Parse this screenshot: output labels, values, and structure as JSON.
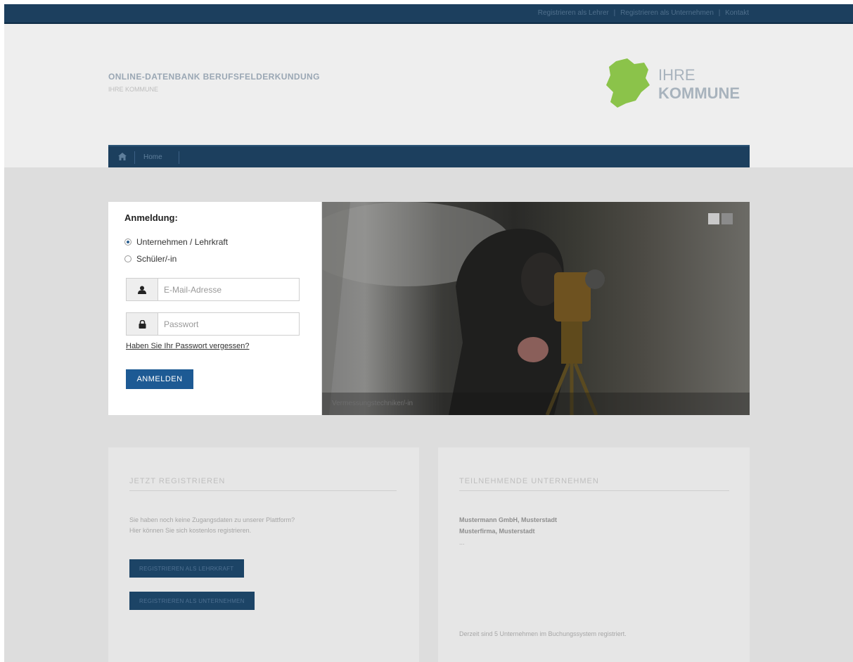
{
  "topbar": {
    "links": [
      "Registrieren als Lehrer",
      "Registrieren als Unternehmen",
      "Kontakt"
    ],
    "separator": "|"
  },
  "header": {
    "title": "ONLINE-DATENBANK BERUFSFELDERKUNDUNG",
    "subtitle": "IHRE KOMMUNE",
    "logo": {
      "line1": "IHRE",
      "line2": "KOMMUNE",
      "color": "#8bc34a"
    }
  },
  "nav": {
    "home_icon": "home-icon",
    "item": "Home"
  },
  "login": {
    "title": "Anmeldung:",
    "role_options": [
      {
        "label": "Unternehmen / Lehrkraft",
        "checked": true
      },
      {
        "label": "Schüler/-in",
        "checked": false
      }
    ],
    "email": {
      "placeholder": "E-Mail-Adresse",
      "value": "",
      "icon": "user-icon"
    },
    "password": {
      "placeholder": "Passwort",
      "value": "",
      "icon": "lock-icon"
    },
    "forgot_link": "Haben Sie Ihr Passwort vergessen?",
    "submit_label": "ANMELDEN",
    "accent": "#1d5a94"
  },
  "hero": {
    "caption": "Vermessungstechniker/-in",
    "slides": 2,
    "active_slide": 1
  },
  "cards": {
    "register": {
      "title": "JETZT REGISTRIEREN",
      "text_line1": "Sie haben noch keine Zugangsdaten zu unserer Plattform?",
      "text_line2": "Hier können Sie sich kostenlos registrieren.",
      "teacher_button": "REGISTRIEREN ALS LEHRKRAFT",
      "company_button": "REGISTRIEREN ALS UNTERNEHMEN"
    },
    "companies": {
      "title": "TEILNEHMENDE UNTERNEHMEN",
      "company1": "Mustermann GmbH, Musterstadt",
      "company2": "Musterfirma, Musterstadt",
      "ellipsis": "...",
      "footer": "Derzeit sind 5 Unternehmen im Buchungssystem registriert."
    }
  }
}
